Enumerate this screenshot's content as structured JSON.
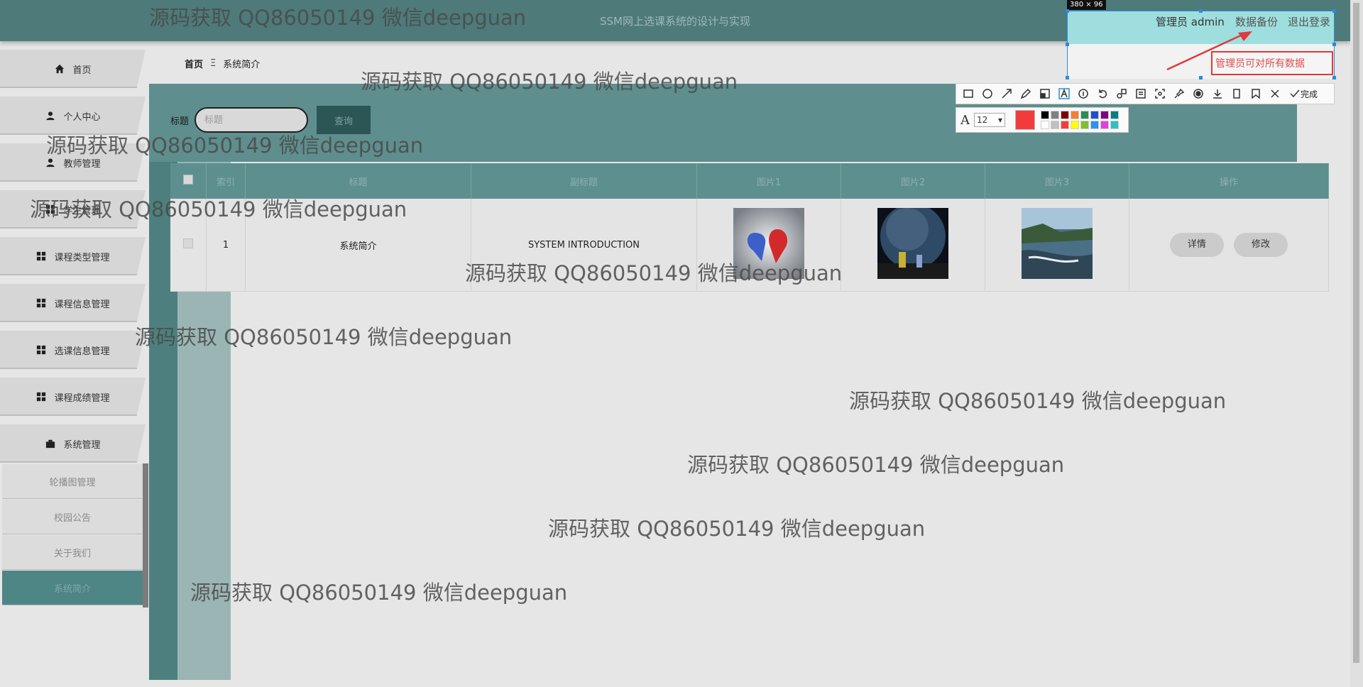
{
  "header": {
    "system_title": "SSM网上选课系统的设计与实现"
  },
  "user_bar": {
    "role_user": "管理员 admin",
    "backup": "数据备份",
    "logout": "退出登录"
  },
  "sidebar": {
    "items": [
      {
        "label": "首页",
        "icon": "home-icon"
      },
      {
        "label": "个人中心",
        "icon": "user-icon"
      },
      {
        "label": "教师管理",
        "icon": "user-icon"
      },
      {
        "label": "学生管理",
        "icon": "grid-icon"
      },
      {
        "label": "课程类型管理",
        "icon": "grid-icon"
      },
      {
        "label": "课程信息管理",
        "icon": "grid-icon"
      },
      {
        "label": "选课信息管理",
        "icon": "grid-icon"
      },
      {
        "label": "课程成绩管理",
        "icon": "grid-icon"
      },
      {
        "label": "系统管理",
        "icon": "briefcase-icon"
      }
    ],
    "subitems": [
      {
        "label": "轮播图管理"
      },
      {
        "label": "校园公告"
      },
      {
        "label": "关于我们"
      },
      {
        "label": "系统简介"
      }
    ]
  },
  "breadcrumb": {
    "home": "首页",
    "separator": "Ξ",
    "current": "系统简介"
  },
  "search": {
    "label": "标题",
    "placeholder": "标题",
    "button": "查询"
  },
  "table": {
    "headers": [
      "索引",
      "标题",
      "副标题",
      "图片1",
      "图片2",
      "图片3",
      "操作"
    ],
    "rows": [
      {
        "index": "1",
        "title": "系统简介",
        "subtitle": "SYSTEM INTRODUCTION",
        "detail_btn": "详情",
        "edit_btn": "修改"
      }
    ]
  },
  "watermark": "源码获取 QQ86050149 微信deepguan",
  "screenshot_tool": {
    "size_label": "380 × 96",
    "annotation_text": "管理员可对所有数据",
    "font_size": "12",
    "done": "完成",
    "current_color": "#f23c3c",
    "palette": [
      "#000000",
      "#808080",
      "#800000",
      "#f08030",
      "#2e8b57",
      "#2050d0",
      "#800080",
      "#008080",
      "#ffffff",
      "#c0c0c0",
      "#f23c3c",
      "#ffff00",
      "#7fbf30",
      "#3090f0",
      "#e040e0",
      "#30c0c0"
    ]
  },
  "colors": {
    "header": "#4e7a7a",
    "accent": "#5e8f8f",
    "annotation": "#e03a3a"
  }
}
